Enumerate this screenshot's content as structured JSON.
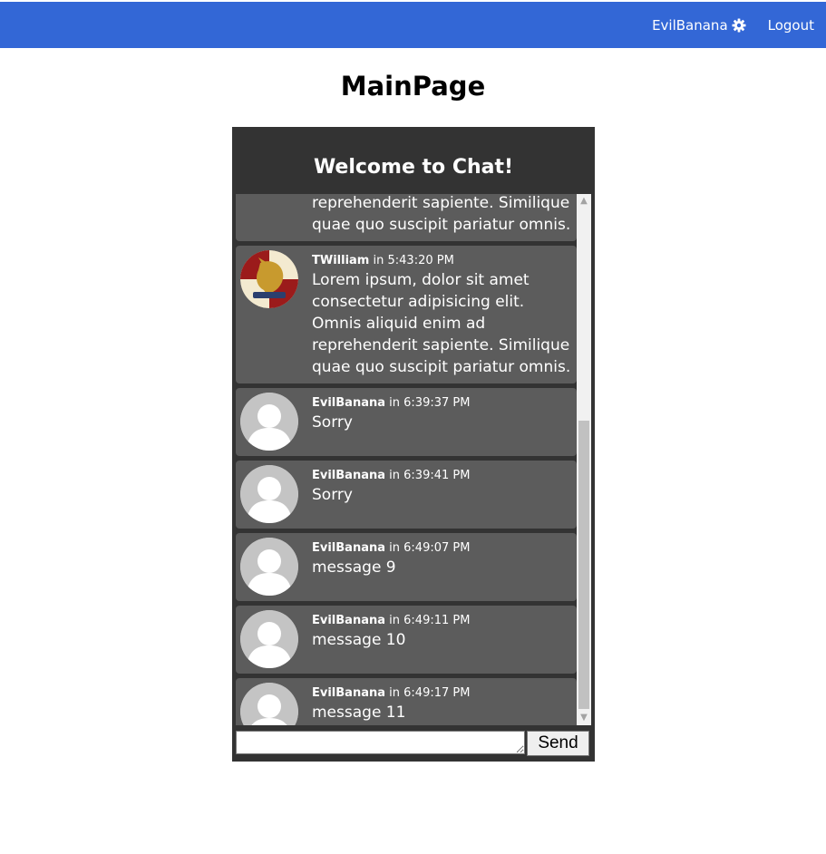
{
  "header": {
    "username": "EvilBanana",
    "settings_icon": "gear-icon",
    "logout_label": "Logout",
    "color": "#3367d6"
  },
  "page": {
    "title": "MainPage"
  },
  "chat": {
    "title": "Welcome to Chat!",
    "send_label": "Send",
    "messages": [
      {
        "author": "",
        "time": "",
        "text": "Lorem ipsum, dolor sit amet consectetur adipisicing elit. Omnis aliquid enim ad reprehenderit sapiente. Similique quae quo suscipit pariatur omnis.",
        "avatar": "crest"
      },
      {
        "author": "TWilliam",
        "time": "5:43:20 PM",
        "text": "Lorem ipsum, dolor sit amet consectetur adipisicing elit. Omnis aliquid enim ad reprehenderit sapiente. Similique quae quo suscipit pariatur omnis.",
        "avatar": "crest"
      },
      {
        "author": "EvilBanana",
        "time": "6:39:37 PM",
        "text": "Sorry",
        "avatar": "default"
      },
      {
        "author": "EvilBanana",
        "time": "6:39:41 PM",
        "text": "Sorry",
        "avatar": "default"
      },
      {
        "author": "EvilBanana",
        "time": "6:49:07 PM",
        "text": "message 9",
        "avatar": "default"
      },
      {
        "author": "EvilBanana",
        "time": "6:49:11 PM",
        "text": "message 10",
        "avatar": "default"
      },
      {
        "author": "EvilBanana",
        "time": "6:49:17 PM",
        "text": "message 11",
        "avatar": "default"
      }
    ],
    "in_word": "in"
  }
}
